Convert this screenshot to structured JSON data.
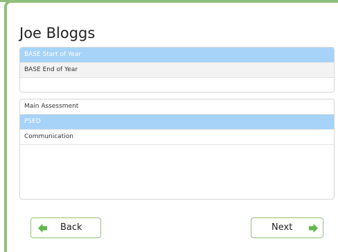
{
  "student": {
    "name": "Joe Bloggs"
  },
  "assessment_periods": {
    "items": [
      {
        "label": "BASE Start of Year",
        "selected": true
      },
      {
        "label": "BASE End of Year",
        "selected": false
      }
    ]
  },
  "assessment_areas": {
    "items": [
      {
        "label": "Main Assessment",
        "selected": false
      },
      {
        "label": "PSED",
        "selected": true
      },
      {
        "label": "Communication",
        "selected": false
      }
    ]
  },
  "navigation": {
    "back_label": "Back",
    "next_label": "Next",
    "back_icon": "arrow-left-icon",
    "next_icon": "arrow-right-icon"
  },
  "colors": {
    "accent_green": "#8fbf7a",
    "selection_blue": "#a6d3f7",
    "arrow_green": "#5fb84a"
  }
}
